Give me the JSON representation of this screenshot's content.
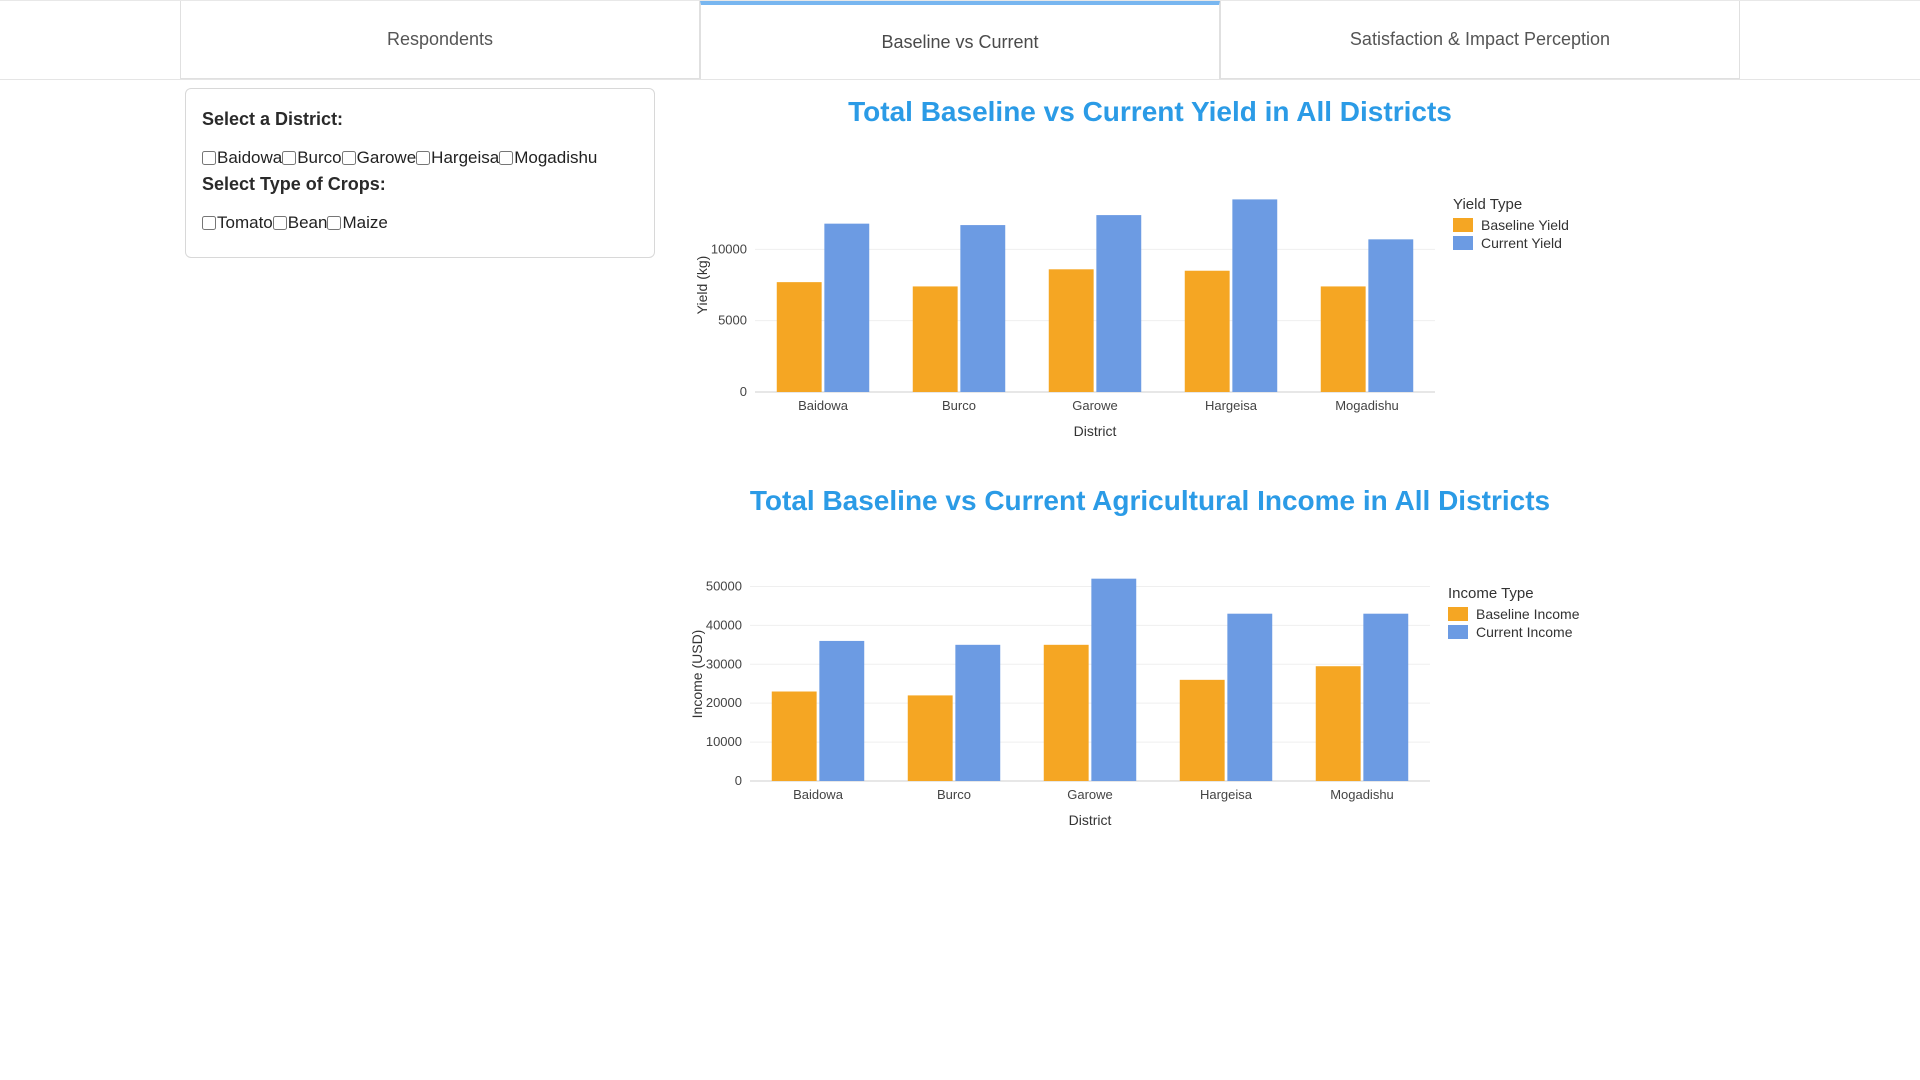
{
  "tabs": {
    "respondents": "Respondents",
    "baseline_vs_current": "Baseline vs Current",
    "satisfaction_impact": "Satisfaction & Impact Perception"
  },
  "filters": {
    "district_label": "Select a District:",
    "districts": [
      "Baidowa",
      "Burco",
      "Garowe",
      "Hargeisa",
      "Mogadishu"
    ],
    "crops_label": "Select Type of Crops:",
    "crops": [
      "Tomato",
      "Bean",
      "Maize"
    ]
  },
  "chart1": {
    "title": "Total Baseline vs Current Yield in All Districts",
    "xlabel": "District",
    "ylabel": "Yield (kg)",
    "legend_title": "Yield Type",
    "legend": [
      "Baseline Yield",
      "Current Yield"
    ]
  },
  "chart2": {
    "title": "Total Baseline vs Current Agricultural Income in All Districts",
    "xlabel": "District",
    "ylabel": "Income (USD)",
    "legend_title": "Income Type",
    "legend": [
      "Baseline Income",
      "Current Income"
    ]
  },
  "colors": {
    "baseline": "#f5a623",
    "current": "#6c9be3",
    "axis": "#d9d9d9",
    "title": "#2b9be6"
  },
  "chart_data": [
    {
      "type": "bar",
      "title": "Total Baseline vs Current Yield in All Districts",
      "xlabel": "District",
      "ylabel": "Yield (kg)",
      "categories": [
        "Baidowa",
        "Burco",
        "Garowe",
        "Hargeisa",
        "Mogadishu"
      ],
      "series": [
        {
          "name": "Baseline Yield",
          "color": "#f5a623",
          "values": [
            7700,
            7400,
            8600,
            8500,
            7400
          ]
        },
        {
          "name": "Current Yield",
          "color": "#6c9be3",
          "values": [
            11800,
            11700,
            12400,
            13500,
            10700
          ]
        }
      ],
      "y_ticks": [
        0,
        5000,
        10000
      ],
      "ylim": [
        0,
        15000
      ]
    },
    {
      "type": "bar",
      "title": "Total Baseline vs Current Agricultural Income in All Districts",
      "xlabel": "District",
      "ylabel": "Income (USD)",
      "categories": [
        "Baidowa",
        "Burco",
        "Garowe",
        "Hargeisa",
        "Mogadishu"
      ],
      "series": [
        {
          "name": "Baseline Income",
          "color": "#f5a623",
          "values": [
            23000,
            22000,
            35000,
            26000,
            29500
          ]
        },
        {
          "name": "Current Income",
          "color": "#6c9be3",
          "values": [
            36000,
            35000,
            52000,
            43000,
            43000
          ]
        }
      ],
      "y_ticks": [
        0,
        10000,
        20000,
        30000,
        40000,
        50000
      ],
      "ylim": [
        0,
        55000
      ]
    }
  ]
}
